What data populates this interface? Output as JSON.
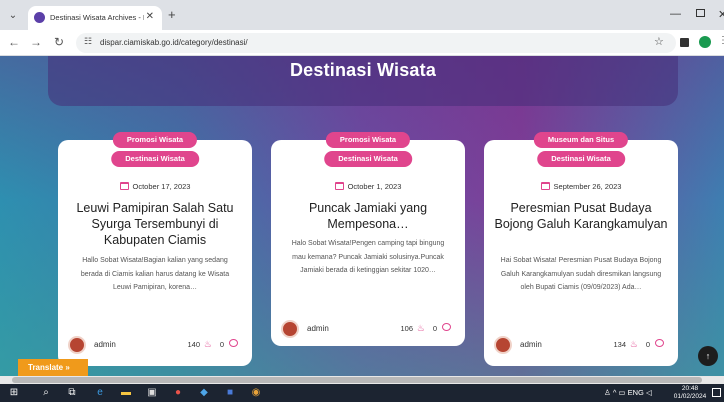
{
  "browser": {
    "tab_title": "Destinasi Wisata Archives - DIS",
    "tab_close": "✕",
    "new_tab": "+",
    "url": "dispar.ciamiskab.go.id/category/destinasi/",
    "window_min": "—",
    "window_close": "✕",
    "icons": [
      "back-icon",
      "forward-icon",
      "reload-icon",
      "site-info-icon",
      "star-icon",
      "profile-icon",
      "more-icon"
    ]
  },
  "page": {
    "hero_title": "Destinasi Wisata",
    "translate_label": "Translate »",
    "scroll_top_label": "↑"
  },
  "cards": [
    {
      "category_1": "Promosi Wisata",
      "category_2": "Destinasi Wisata",
      "date": "October 17, 2023",
      "title": "Leuwi Pamipiran Salah Satu Syurga Tersembunyi di Kabupaten Ciamis",
      "excerpt": "Hallo Sobat Wisata!Bagian kalian yang sedang berada di Ciamis kalian harus datang ke Wisata Leuwi Pamipiran, korena…",
      "author": "admin",
      "views": "140",
      "comments": "0"
    },
    {
      "category_1": "Promosi Wisata",
      "category_2": "Destinasi Wisata",
      "date": "October 1, 2023",
      "title": "Puncak Jamiaki yang Mempesona…",
      "excerpt": "Halo Sobat Wisata!Pengen camping tapi bingung mau kemana? Puncak Jamiaki solusinya.Puncak Jamiaki berada di ketinggian sekitar 1020…",
      "author": "admin",
      "views": "106",
      "comments": "0"
    },
    {
      "category_1": "Museum dan Situs",
      "category_2": "Destinasi Wisata",
      "date": "September 26, 2023",
      "title": "Peresmian Pusat Budaya Bojong Galuh Karangkamulyan",
      "excerpt": "Hai Sobat Wisata! Peresmian Pusat Budaya Bojong Galuh Karangkamulyan sudah diresmikan langsung oleh Bupati Ciamis (09/09/2023) Ada…",
      "author": "admin",
      "views": "134",
      "comments": "0"
    }
  ],
  "taskbar": {
    "tray_text": "ENG",
    "clock_time": "20:48",
    "clock_date": "01/02/2024"
  },
  "colors": {
    "accent_pink": "#e0458d",
    "translate_orange": "#f09a1b"
  }
}
